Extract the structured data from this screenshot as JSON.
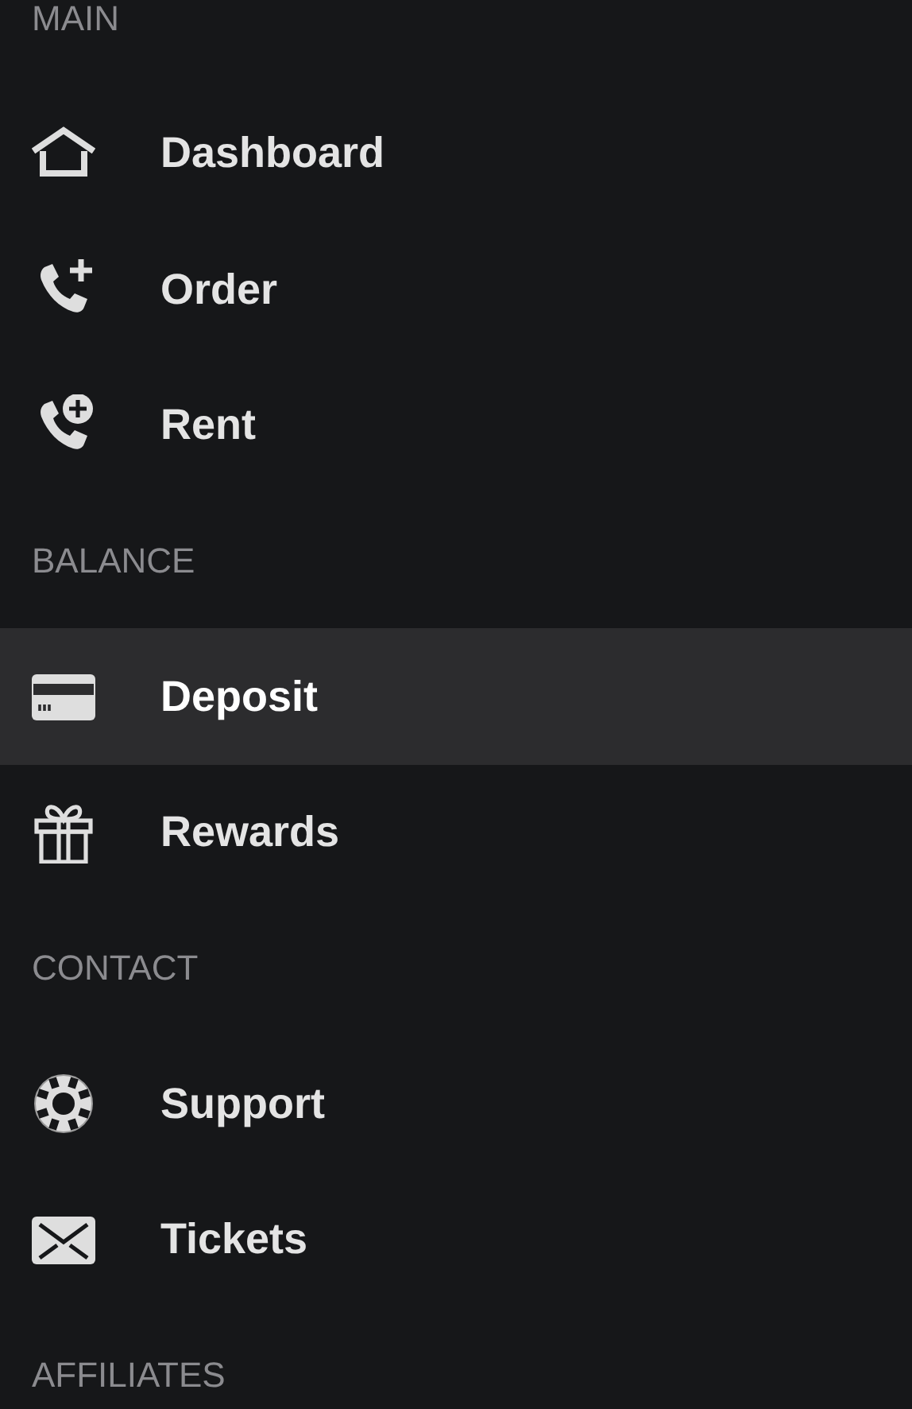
{
  "sidebar": {
    "sections": [
      {
        "title": "MAIN",
        "items": [
          {
            "label": "Dashboard",
            "kind": "home",
            "selected": false
          },
          {
            "label": "Order",
            "kind": "phone-plus",
            "selected": false
          },
          {
            "label": "Rent",
            "kind": "phone-circle-plus",
            "selected": false
          }
        ]
      },
      {
        "title": "BALANCE",
        "items": [
          {
            "label": "Deposit",
            "kind": "card",
            "selected": true
          },
          {
            "label": "Rewards",
            "kind": "gift",
            "selected": false
          }
        ]
      },
      {
        "title": "CONTACT",
        "items": [
          {
            "label": "Support",
            "kind": "lifebuoy",
            "selected": false
          },
          {
            "label": "Tickets",
            "kind": "envelope",
            "selected": false
          }
        ]
      },
      {
        "title": "AFFILIATES"
      }
    ]
  }
}
